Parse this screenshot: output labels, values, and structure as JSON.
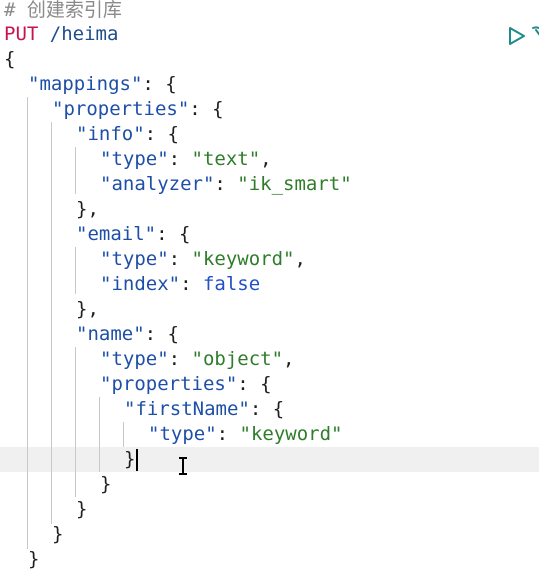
{
  "request": {
    "comment": "# 创建索引库",
    "method": "PUT",
    "path": "/heima"
  },
  "body_lines": [
    "{",
    "\"mappings\": {",
    "\"properties\": {",
    "\"info\": {",
    "\"type\": \"text\",",
    "\"analyzer\": \"ik_smart\"",
    "},",
    "\"email\": {",
    "\"type\": \"keyword\",",
    "\"index\": false",
    "},",
    "\"name\": {",
    "\"type\": \"object\",",
    "\"properties\": {",
    "\"firstName\": {",
    "\"type\": \"keyword\"",
    "}",
    "}",
    "}",
    "}",
    "}"
  ],
  "toolbar": {
    "run_icon": "play-triangle",
    "settings_icon": "wrench"
  },
  "colors": {
    "method": "#c4134f",
    "key": "#1e4fa8",
    "string": "#2f7d2a",
    "boolean": "#2350c7",
    "comment": "#8a8a8a"
  }
}
